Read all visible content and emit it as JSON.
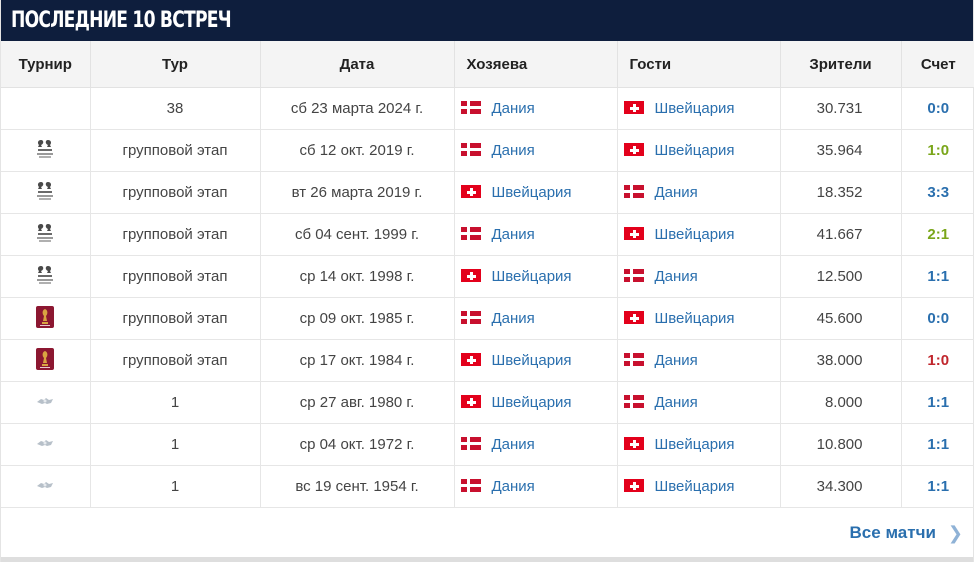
{
  "title": "ПОСЛЕДНИЕ 10 ВСТРЕЧ",
  "columns": {
    "tournament": "Турнир",
    "round": "Тур",
    "date": "Дата",
    "home": "Хозяева",
    "away": "Гости",
    "viewers": "Зрители",
    "score": "Счет"
  },
  "matches": [
    {
      "tournament_icon": "nations-league-icon",
      "round": "38",
      "date": "сб 23 марта 2024 г.",
      "home": {
        "name": "Дания",
        "flag": "denmark-flag-icon"
      },
      "away": {
        "name": "Швейцария",
        "flag": "switzerland-flag-icon"
      },
      "viewers": "30.731",
      "score": "0:0",
      "result": "draw"
    },
    {
      "tournament_icon": "euro-qualifiers-icon",
      "round": "групповой этап",
      "date": "сб 12 окт. 2019 г.",
      "home": {
        "name": "Дания",
        "flag": "denmark-flag-icon"
      },
      "away": {
        "name": "Швейцария",
        "flag": "switzerland-flag-icon"
      },
      "viewers": "35.964",
      "score": "1:0",
      "result": "win"
    },
    {
      "tournament_icon": "euro-qualifiers-icon",
      "round": "групповой этап",
      "date": "вт 26 марта 2019 г.",
      "home": {
        "name": "Швейцария",
        "flag": "switzerland-flag-icon"
      },
      "away": {
        "name": "Дания",
        "flag": "denmark-flag-icon"
      },
      "viewers": "18.352",
      "score": "3:3",
      "result": "draw"
    },
    {
      "tournament_icon": "euro-qualifiers-icon",
      "round": "групповой этап",
      "date": "сб 04 сент. 1999 г.",
      "home": {
        "name": "Дания",
        "flag": "denmark-flag-icon"
      },
      "away": {
        "name": "Швейцария",
        "flag": "switzerland-flag-icon"
      },
      "viewers": "41.667",
      "score": "2:1",
      "result": "win"
    },
    {
      "tournament_icon": "euro-qualifiers-icon",
      "round": "групповой этап",
      "date": "ср 14 окт. 1998 г.",
      "home": {
        "name": "Швейцария",
        "flag": "switzerland-flag-icon"
      },
      "away": {
        "name": "Дания",
        "flag": "denmark-flag-icon"
      },
      "viewers": "12.500",
      "score": "1:1",
      "result": "draw"
    },
    {
      "tournament_icon": "world-cup-qualifiers-icon",
      "round": "групповой этап",
      "date": "ср 09 окт. 1985 г.",
      "home": {
        "name": "Дания",
        "flag": "denmark-flag-icon"
      },
      "away": {
        "name": "Швейцария",
        "flag": "switzerland-flag-icon"
      },
      "viewers": "45.600",
      "score": "0:0",
      "result": "draw"
    },
    {
      "tournament_icon": "world-cup-qualifiers-icon",
      "round": "групповой этап",
      "date": "ср 17 окт. 1984 г.",
      "home": {
        "name": "Швейцария",
        "flag": "switzerland-flag-icon"
      },
      "away": {
        "name": "Дания",
        "flag": "denmark-flag-icon"
      },
      "viewers": "38.000",
      "score": "1:0",
      "result": "loss"
    },
    {
      "tournament_icon": "friendly-match-icon",
      "round": "1",
      "date": "ср 27 авг. 1980 г.",
      "home": {
        "name": "Швейцария",
        "flag": "switzerland-flag-icon"
      },
      "away": {
        "name": "Дания",
        "flag": "denmark-flag-icon"
      },
      "viewers": "8.000",
      "score": "1:1",
      "result": "draw"
    },
    {
      "tournament_icon": "friendly-match-icon",
      "round": "1",
      "date": "ср 04 окт. 1972 г.",
      "home": {
        "name": "Дания",
        "flag": "denmark-flag-icon"
      },
      "away": {
        "name": "Швейцария",
        "flag": "switzerland-flag-icon"
      },
      "viewers": "10.800",
      "score": "1:1",
      "result": "draw"
    },
    {
      "tournament_icon": "friendly-match-icon",
      "round": "1",
      "date": "вс 19 сент. 1954 г.",
      "home": {
        "name": "Дания",
        "flag": "denmark-flag-icon"
      },
      "away": {
        "name": "Швейцария",
        "flag": "switzerland-flag-icon"
      },
      "viewers": "34.300",
      "score": "1:1",
      "result": "draw"
    }
  ],
  "footer": {
    "all_matches_label": "Все матчи",
    "chevron_icon": "chevron-right-icon"
  },
  "colors": {
    "header_bg": "#0e1e3d",
    "link": "#2a6fae",
    "win": "#7aa61a",
    "loss": "#c0262d",
    "draw": "#2a6fae"
  }
}
